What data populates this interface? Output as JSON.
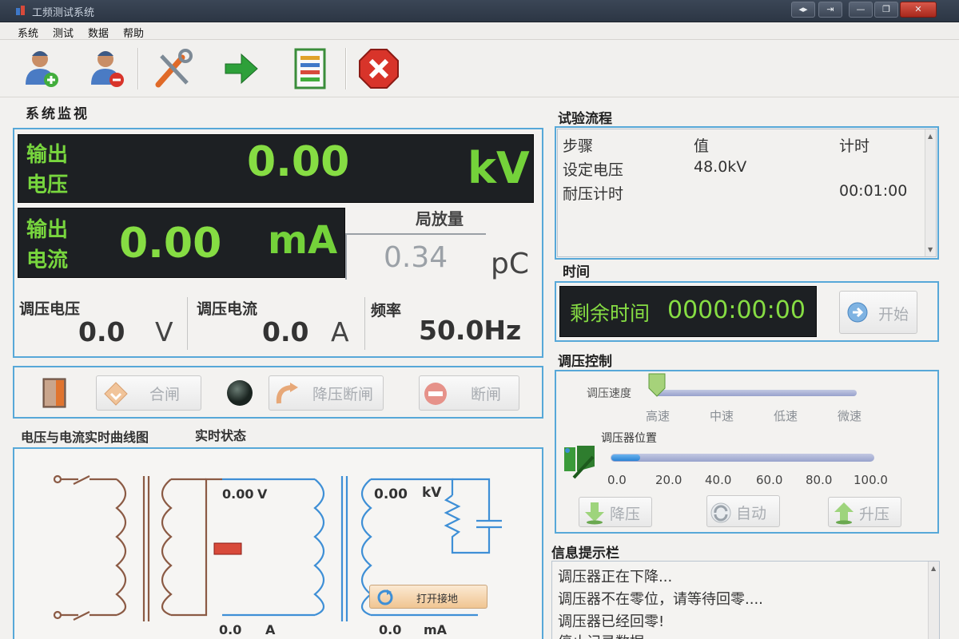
{
  "window": {
    "title": "工频测试系统",
    "controls": [
      "◂▸",
      "⇥",
      "—",
      "❐",
      "✕"
    ]
  },
  "menu": {
    "items": [
      "系统",
      "测试",
      "数据",
      "帮助"
    ]
  },
  "toolbar": {
    "buttons": [
      "add-user",
      "remove-user",
      "tools",
      "export",
      "report",
      "exit"
    ]
  },
  "monitor": {
    "title": "系统监视",
    "voltage": {
      "label_line1": "输出",
      "label_line2": "电压",
      "value": "0.00",
      "unit": "kV"
    },
    "current": {
      "label_line1": "输出",
      "label_line2": "电流",
      "value": "0.00",
      "unit": "mA"
    },
    "pd": {
      "label": "局放量",
      "value": "0.34",
      "unit": "pC"
    },
    "reg_voltage": {
      "label": "调压电压",
      "value": "0.0",
      "unit": "V"
    },
    "reg_current": {
      "label": "调压电流",
      "value": "0.0",
      "unit": "A"
    },
    "frequency": {
      "label": "频率",
      "value": "50.0Hz"
    }
  },
  "switch_controls": {
    "close": "合闸",
    "step_down_break": "降压断闸",
    "break": "断闸"
  },
  "curve_tabs": {
    "curve": "电压与电流实时曲线图",
    "status": "实时状态"
  },
  "schematic": {
    "v_value": "0.00",
    "v_unit": "V",
    "a_value": "0.0",
    "a_unit": "A",
    "kv_value": "0.00",
    "kv_unit": "kV",
    "ma_value": "0.0",
    "ma_unit": "mA",
    "ground_button": "打开接地"
  },
  "test_flow": {
    "title": "试验流程",
    "headers": [
      "步骤",
      "值",
      "计时"
    ],
    "rows": [
      {
        "step": "设定电压",
        "value": "48.0kV",
        "time": ""
      },
      {
        "step": "耐压计时",
        "value": "",
        "time": "00:01:00"
      }
    ]
  },
  "time_panel": {
    "title": "时间",
    "remaining_label": "剩余时间",
    "remaining_value": "0000:00:00",
    "start_button": "开始"
  },
  "regulator": {
    "title": "调压控制",
    "speed_label": "调压速度",
    "speed_ticks": [
      "高速",
      "中速",
      "低速",
      "微速"
    ],
    "position_label": "调压器位置",
    "position_ticks": [
      "0.0",
      "20.0",
      "40.0",
      "60.0",
      "80.0",
      "100.0"
    ],
    "position_fraction": 0.11,
    "down_button": "降压",
    "auto_button": "自动",
    "up_button": "升压"
  },
  "info": {
    "title": "信息提示栏",
    "messages": [
      "调压器正在下降...",
      "调压器不在零位，请等待回零....",
      "调压器已经回零!",
      "停止记录数据"
    ]
  },
  "colors": {
    "lcd_green": "#86dd43",
    "frame_blue": "#57a8d8",
    "schematic_brown": "#8b5a44",
    "schematic_blue": "#3e8fd6"
  }
}
